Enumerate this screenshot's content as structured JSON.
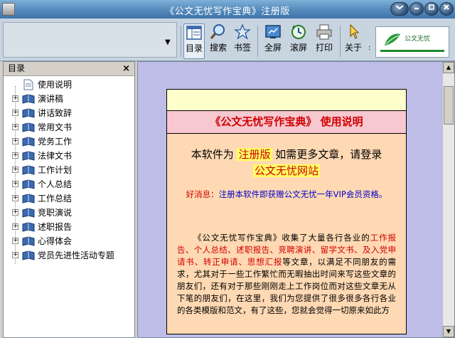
{
  "window": {
    "title": "《公文无忧写作宝典》注册版"
  },
  "toolbar": {
    "buttons": [
      {
        "label": "目录",
        "icon": "table-of-contents-icon"
      },
      {
        "label": "搜索",
        "icon": "magnifier-icon"
      },
      {
        "label": "书签",
        "icon": "bookmark-star-icon"
      },
      {
        "label": "全屏",
        "icon": "fullscreen-icon"
      },
      {
        "label": "滚屏",
        "icon": "auto-scroll-icon"
      },
      {
        "label": "打印",
        "icon": "printer-icon"
      },
      {
        "label": "关于",
        "icon": "pointer-icon"
      }
    ],
    "logo_text": "公文无忧"
  },
  "sidebar": {
    "title": "目录",
    "close_glyph": "×",
    "items": [
      {
        "label": "使用说明",
        "type": "document"
      },
      {
        "label": "演讲稿",
        "type": "book"
      },
      {
        "label": "讲话致辞",
        "type": "book"
      },
      {
        "label": "常用文书",
        "type": "book"
      },
      {
        "label": "党务工作",
        "type": "book"
      },
      {
        "label": "法律文书",
        "type": "book"
      },
      {
        "label": "工作计划",
        "type": "book"
      },
      {
        "label": "个人总结",
        "type": "book"
      },
      {
        "label": "工作总结",
        "type": "book"
      },
      {
        "label": "竞职演说",
        "type": "book"
      },
      {
        "label": "述职报告",
        "type": "book"
      },
      {
        "label": "心得体会",
        "type": "book"
      },
      {
        "label": "党员先进性活动专题",
        "type": "book"
      }
    ]
  },
  "document": {
    "heading": "《公文无忧写作宝典》  使用说明",
    "reg_prefix": "本软件为",
    "reg_highlight": "注册版",
    "reg_suffix": "如需更多文章，请登录",
    "site_highlight": "公文无忧网站",
    "news_head": "好消息：",
    "news_body": "注册本软件即获赠公文无忧一年VIP会员资格。",
    "intro_part1": "《公文无忧写作宝典》收集了大量各行各业的",
    "intro_red": "工作报告、个人总结、述职报告、竞聘演讲、留学文书、及入党申请书、转正申请、思想汇报",
    "intro_part2": "等文章，以满足不同朋友的需求，尤其对于一些工作繁忙而无暇抽出时间来写这些文章的朋友们，还有对于那些刚刚走上工作岗位而对这些文章无从下笔的朋友们，在这里，我们为您提供了很多很多各行各业的各类模版和范文，有了这些，您就会觉得一切原来如此方"
  },
  "colors": {
    "titlebar": "#4f86bc",
    "content_bg": "#bdbde8",
    "doc_bg": "#ffd9b3",
    "heading_bg": "#f7c8d0",
    "accent_red": "#d00000",
    "news_blue": "#0000cc",
    "highlight": "#ffff66"
  }
}
